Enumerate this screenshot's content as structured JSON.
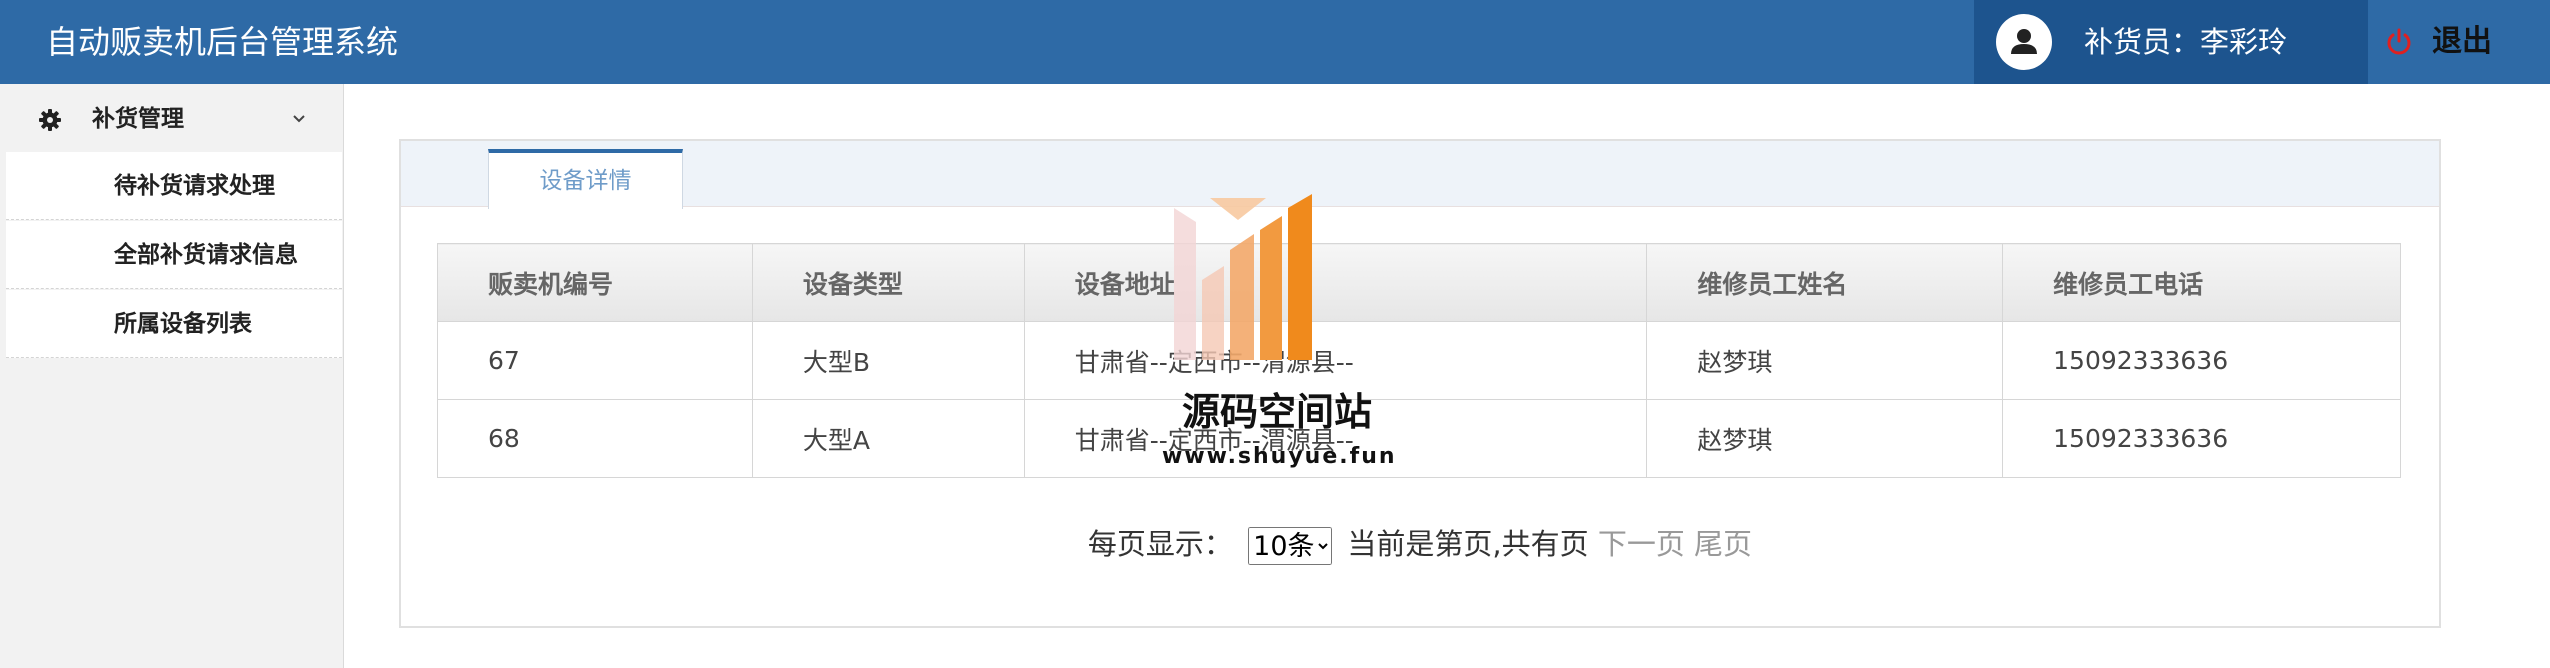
{
  "header": {
    "app_title": "自动贩卖机后台管理系统",
    "user_label": "补货员：李彩玲",
    "logout_label": "退出"
  },
  "sidebar": {
    "group_label": "补货管理",
    "items": [
      {
        "label": "待补货请求处理"
      },
      {
        "label": "全部补货请求信息"
      },
      {
        "label": "所属设备列表"
      }
    ]
  },
  "tab": {
    "label": "设备详情"
  },
  "table": {
    "columns": [
      "贩卖机编号",
      "设备类型",
      "设备地址",
      "维修员工姓名",
      "维修员工电话"
    ],
    "rows": [
      [
        "67",
        "大型B",
        "甘肃省--定西市--渭源县--",
        "赵梦琪",
        "15092333636"
      ],
      [
        "68",
        "大型A",
        "甘肃省--定西市--渭源县--",
        "赵梦琪",
        "15092333636"
      ]
    ]
  },
  "pager": {
    "per_page_label": "每页显示：",
    "per_page_value": "10条",
    "status_text": "当前是第页,共有页",
    "next_label": "下一页",
    "last_label": "尾页"
  },
  "watermark": {
    "title": "源码空间站",
    "url": "www.shuyue.fun"
  },
  "colors": {
    "header_bg": "#2e6aa6",
    "user_box_bg": "#1d548e",
    "logout_icon": "#e02020",
    "tab_text": "#6f9cc9",
    "watermark_orange": "#f08a1c"
  }
}
